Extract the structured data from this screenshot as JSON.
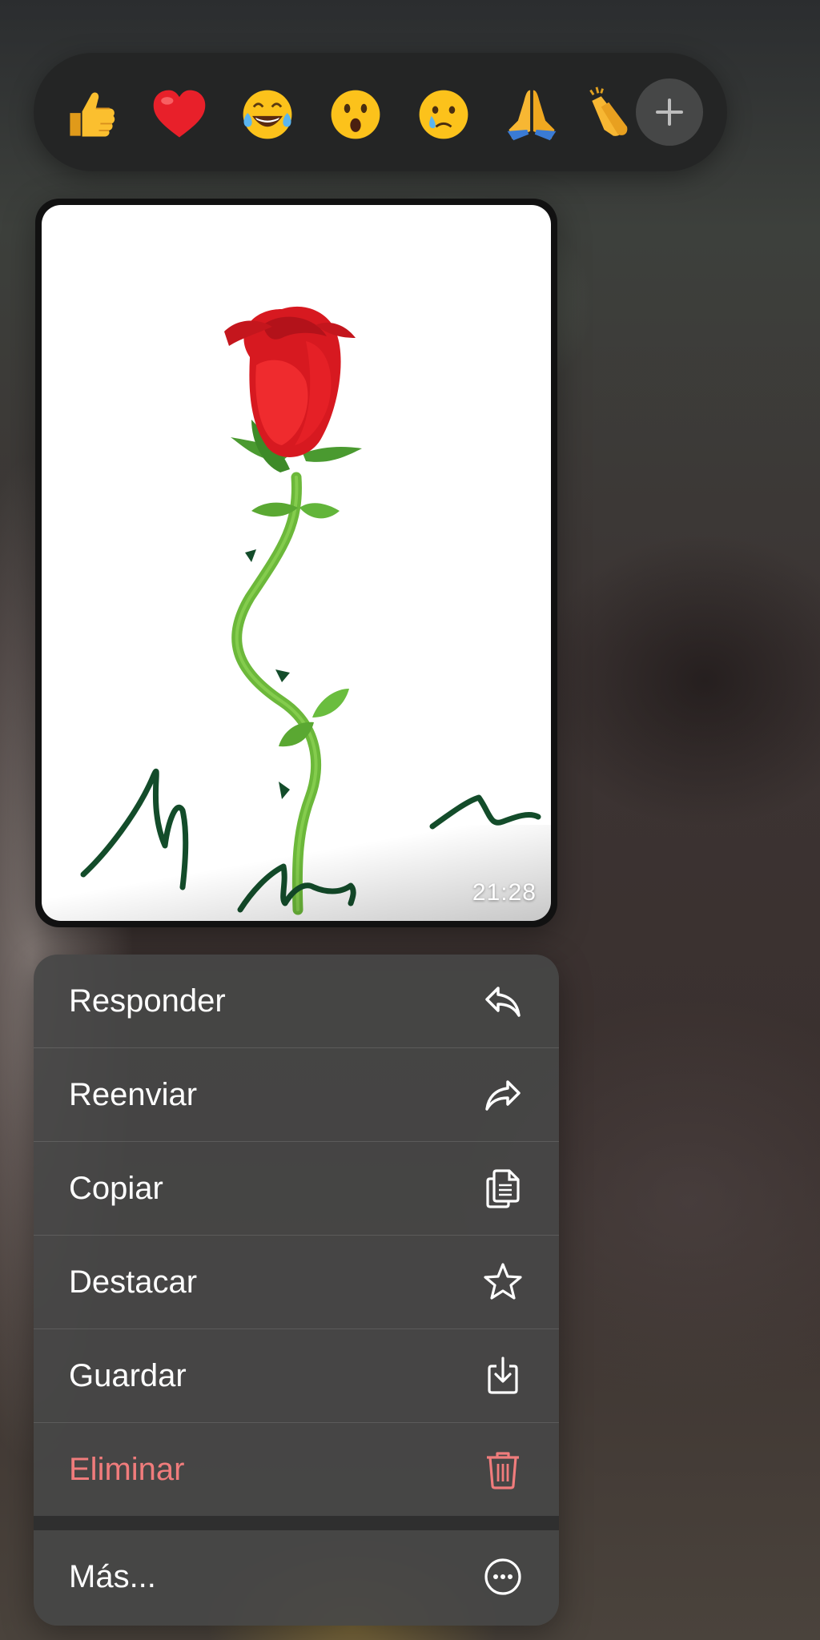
{
  "reactions": {
    "emojis": [
      "👍",
      "❤️",
      "😂",
      "😮",
      "😢",
      "🙏",
      "👏"
    ],
    "more_button": "add-reaction"
  },
  "message": {
    "timestamp": "21:28",
    "content": "drawing of a rose with green stem and scribbles"
  },
  "menu": {
    "items": [
      {
        "label": "Responder",
        "icon": "reply-icon"
      },
      {
        "label": "Reenviar",
        "icon": "forward-icon"
      },
      {
        "label": "Copiar",
        "icon": "copy-icon"
      },
      {
        "label": "Destacar",
        "icon": "star-icon"
      },
      {
        "label": "Guardar",
        "icon": "save-icon"
      },
      {
        "label": "Eliminar",
        "icon": "trash-icon",
        "color": "#f07c7c"
      },
      {
        "label": "Más...",
        "icon": "more-icon"
      }
    ]
  },
  "colors": {
    "menu_background": "#464646",
    "reaction_bar": "#242525",
    "danger": "#f07c7c"
  }
}
